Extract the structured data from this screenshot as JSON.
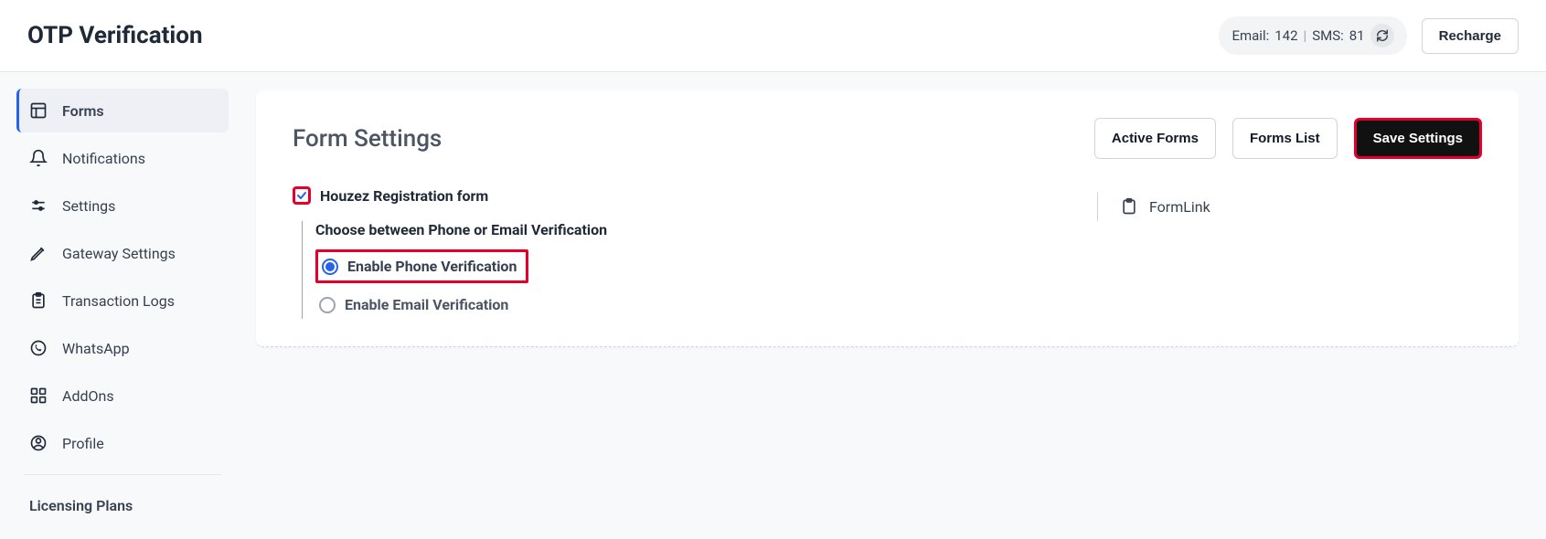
{
  "header": {
    "title": "OTP Verification",
    "email_label": "Email:",
    "email_count": "142",
    "sms_label": "SMS:",
    "sms_count": "81",
    "recharge_label": "Recharge"
  },
  "sidebar": {
    "items": [
      {
        "label": "Forms"
      },
      {
        "label": "Notifications"
      },
      {
        "label": "Settings"
      },
      {
        "label": "Gateway Settings"
      },
      {
        "label": "Transaction Logs"
      },
      {
        "label": "WhatsApp"
      },
      {
        "label": "AddOns"
      },
      {
        "label": "Profile"
      }
    ],
    "licensing": "Licensing Plans"
  },
  "form_settings": {
    "title": "Form Settings",
    "actions": {
      "active_forms": "Active Forms",
      "forms_list": "Forms List",
      "save_settings": "Save Settings"
    },
    "form_name": "Houzez Registration form",
    "choose_label": "Choose between Phone or Email Verification",
    "phone_option": "Enable Phone Verification",
    "email_option": "Enable Email Verification",
    "formlink_label": "FormLink"
  }
}
